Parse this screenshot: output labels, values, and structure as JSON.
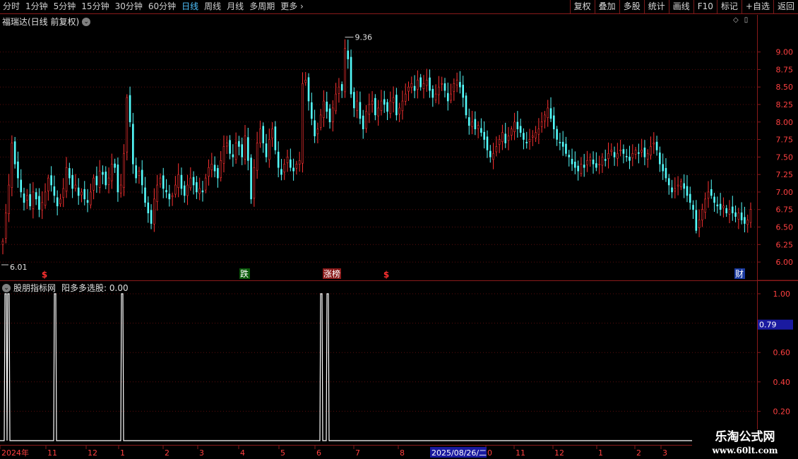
{
  "toolbar": {
    "periods": [
      "分时",
      "1分钟",
      "5分钟",
      "15分钟",
      "30分钟",
      "60分钟",
      "日线",
      "周线",
      "月线",
      "多周期",
      "更多"
    ],
    "active_period": "日线",
    "right_buttons": [
      "复权",
      "叠加",
      "多股",
      "统计",
      "画线",
      "F10",
      "标记",
      "+自选",
      "返回"
    ]
  },
  "price_panel": {
    "title": "福瑞达(日线 前复权)",
    "high_label": "9.36",
    "low_label": "6.01",
    "axis_ticks": [
      "9.00",
      "8.75",
      "8.50",
      "8.25",
      "8.00",
      "7.75",
      "7.50",
      "7.25",
      "7.00",
      "6.75",
      "6.50",
      "6.25",
      "6.00"
    ],
    "markers": [
      {
        "text": "$",
        "kind": "dollar"
      },
      {
        "text": "跌",
        "kind": "fall"
      },
      {
        "text": "涨榜",
        "kind": "rise"
      },
      {
        "text": "$",
        "kind": "dollar"
      },
      {
        "text": "财",
        "kind": "fin"
      }
    ]
  },
  "indicator_panel": {
    "name": "股朋指标网",
    "series_label": "阳多多选股: 0.00",
    "axis_ticks": [
      "1.00",
      "0.80",
      "0.60",
      "0.40",
      "0.20"
    ],
    "cursor_value": "0.79"
  },
  "date_axis": {
    "labels": [
      "2024年",
      "11",
      "12",
      "1",
      "2",
      "3",
      "4",
      "5",
      "6",
      "7",
      "8",
      "0",
      "11",
      "12",
      "1",
      "2",
      "3"
    ],
    "highlight_date": "2025/08/26/二"
  },
  "watermark": {
    "line1": "乐淘公式网",
    "line2": "www.60lt.com"
  },
  "chart_data": {
    "type": "candlestick",
    "y_range": [
      5.9,
      9.45
    ],
    "closes": [
      6.3,
      6.7,
      7.1,
      7.7,
      7.4,
      7.2,
      7.0,
      6.85,
      6.95,
      6.8,
      7.0,
      6.9,
      6.75,
      6.85,
      7.0,
      7.2,
      7.1,
      6.95,
      6.8,
      6.9,
      7.05,
      7.35,
      7.2,
      7.05,
      7.1,
      6.95,
      7.0,
      6.9,
      6.85,
      7.0,
      7.2,
      7.1,
      7.3,
      7.25,
      7.1,
      7.2,
      7.4,
      7.35,
      7.0,
      7.1,
      7.55,
      8.35,
      8.0,
      7.4,
      7.2,
      7.3,
      7.1,
      6.85,
      6.7,
      6.55,
      6.9,
      7.1,
      7.2,
      7.05,
      7.0,
      6.9,
      6.95,
      7.1,
      7.25,
      7.05,
      6.95,
      7.1,
      7.2,
      7.1,
      7.0,
      7.05,
      7.0,
      7.2,
      7.35,
      7.4,
      7.3,
      7.2,
      7.45,
      7.65,
      7.7,
      7.55,
      7.5,
      7.7,
      7.65,
      7.5,
      7.8,
      7.45,
      6.9,
      7.35,
      7.7,
      7.9,
      7.7,
      7.5,
      7.75,
      7.9,
      7.6,
      7.35,
      7.25,
      7.4,
      7.5,
      7.35,
      7.3,
      7.4,
      7.45,
      8.55,
      8.6,
      8.3,
      8.05,
      7.8,
      7.9,
      8.1,
      8.3,
      8.15,
      8.0,
      8.2,
      8.4,
      8.5,
      8.45,
      9.05,
      8.9,
      8.4,
      8.2,
      8.3,
      8.05,
      7.9,
      8.15,
      8.25,
      8.3,
      8.1,
      8.2,
      8.3,
      8.25,
      8.15,
      8.3,
      8.35,
      8.1,
      8.2,
      8.3,
      8.4,
      8.5,
      8.55,
      8.45,
      8.6,
      8.5,
      8.55,
      8.6,
      8.45,
      8.35,
      8.4,
      8.5,
      8.55,
      8.45,
      8.3,
      8.4,
      8.55,
      8.6,
      8.5,
      8.35,
      8.1,
      7.95,
      8.0,
      7.9,
      7.95,
      7.85,
      7.75,
      7.6,
      7.5,
      7.55,
      7.65,
      7.75,
      7.85,
      7.7,
      7.8,
      7.9,
      8.0,
      7.9,
      7.85,
      7.75,
      7.7,
      7.75,
      7.8,
      7.85,
      7.9,
      8.0,
      8.1,
      8.2,
      8.05,
      7.9,
      7.75,
      7.7,
      7.65,
      7.55,
      7.5,
      7.4,
      7.35,
      7.3,
      7.4,
      7.35,
      7.45,
      7.5,
      7.4,
      7.35,
      7.4,
      7.5,
      7.45,
      7.55,
      7.6,
      7.5,
      7.55,
      7.6,
      7.55,
      7.5,
      7.45,
      7.55,
      7.6,
      7.55,
      7.6,
      7.5,
      7.55,
      7.65,
      7.7,
      7.6,
      7.4,
      7.3,
      7.2,
      7.1,
      7.0,
      7.05,
      7.1,
      7.15,
      7.05,
      6.95,
      6.85,
      6.75,
      6.45,
      6.6,
      6.75,
      6.9,
      7.0,
      6.95,
      6.85,
      6.8,
      6.75,
      6.8,
      6.7,
      6.75,
      6.7,
      6.65,
      6.7,
      6.6,
      6.55,
      6.6,
      6.75
    ],
    "spikes": [
      [
        0.009,
        0.009
      ],
      [
        0.072
      ],
      [
        0.162
      ],
      [
        0.425,
        0.433
      ]
    ],
    "indicator_line": "阳多多选股"
  }
}
